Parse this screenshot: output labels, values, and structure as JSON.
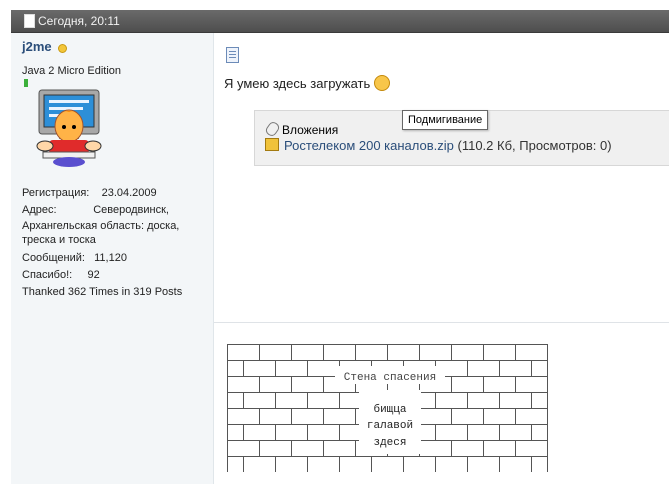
{
  "post_header": {
    "date": "Сегодня, 20:11"
  },
  "user": {
    "name": "j2me",
    "title": "Java 2 Micro Edition",
    "registration_label": "Регистрация:",
    "registration_value": "23.04.2009",
    "address_label": "Адрес:",
    "address_value_1": "Северодвинск,",
    "address_value_2": "Архангельская область: доска, треска и тоска",
    "messages_label": "Сообщений:",
    "messages_value": "11,120",
    "thanks_label": "Спасибо!:",
    "thanks_value": "92",
    "thanked": "Thanked 362 Times in 319 Posts"
  },
  "post": {
    "message": "Я умею здесь загружать",
    "tooltip": "Подмигивание",
    "attachments_title": "Вложения",
    "file_name": "Ростелеком 200 каналов.zip",
    "file_info": " (110.2 Кб, Просмотров: 0)"
  },
  "signature": {
    "wall_title": "Стена спасения",
    "line_1": "бищца",
    "line_2": "галавой",
    "line_3": "здеся"
  },
  "icons": [
    "document-icon",
    "online-status-icon",
    "post-icon",
    "smiley-icon",
    "paperclip-icon",
    "zip-file-icon"
  ]
}
